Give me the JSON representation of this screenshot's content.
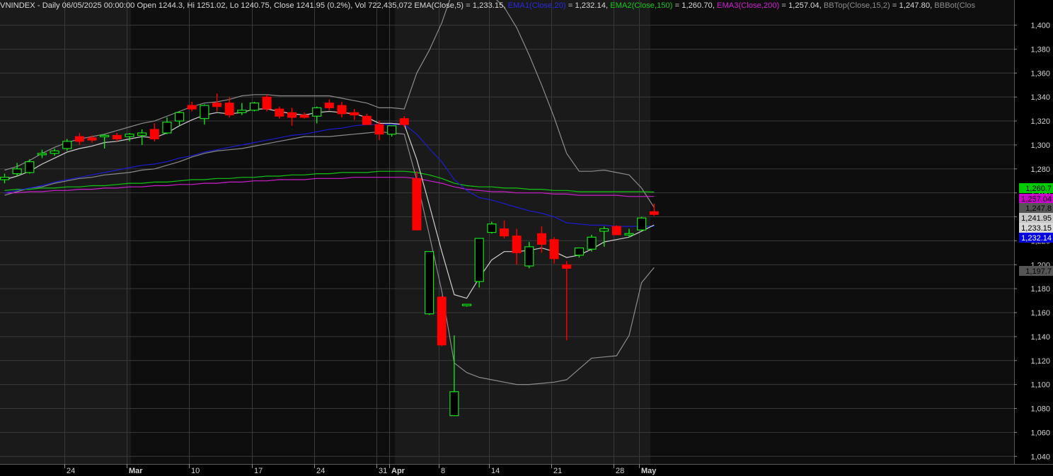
{
  "header": {
    "symbol": "VNINDEX",
    "period": "Daily",
    "datetime": "06/05/2025 00:00:00",
    "open_label": "Open",
    "open": "1244.3",
    "hi_label": "Hi",
    "hi": "1251.02",
    "lo_label": "Lo",
    "lo": "1240.75",
    "close_label": "Close",
    "close": "1241.95",
    "change": "(0.2%)",
    "vol_label": "Vol",
    "vol": "722,435,072",
    "ema5_label": "EMA(Close,5)",
    "ema5": "1,233.15",
    "ema1_label": "EMA1(Close,20)",
    "ema1": "1,232.14",
    "ema2_label": "EMA2(Close,150)",
    "ema2": "1,260.70",
    "ema3_label": "EMA3(Close,200)",
    "ema3": "1,257.04",
    "bbtop_label": "BBTop(Close,15,2)",
    "bbtop": "1,247.80",
    "bbbot_label": "BBBot(Clos"
  },
  "colors": {
    "background": "#000000",
    "band_light": "#1a1a1a",
    "band_dark": "#0e0e0e",
    "grid": "#3a3a3a",
    "up": "#18e018",
    "down": "#ff0000",
    "ema5": "#d0d0d0",
    "ema20": "#1c1ccf",
    "ema150": "#13c413",
    "ema200": "#cc1fcc",
    "bollinger": "#8c8c8c",
    "axis_text": "#d4d4d4"
  },
  "chart_data": {
    "type": "candlestick",
    "ylim": [
      1030,
      1410
    ],
    "yticks": [
      {
        "v": 1400,
        "label": "1,400"
      },
      {
        "v": 1380,
        "label": "1,380"
      },
      {
        "v": 1360,
        "label": "1,360"
      },
      {
        "v": 1340,
        "label": "1,340"
      },
      {
        "v": 1320,
        "label": "1,320"
      },
      {
        "v": 1300,
        "label": "1,300"
      },
      {
        "v": 1280,
        "label": "1,280"
      },
      {
        "v": 1260,
        "label": "1,260"
      },
      {
        "v": 1240,
        "label": "1,240"
      },
      {
        "v": 1220,
        "label": "1,220"
      },
      {
        "v": 1200,
        "label": "1,200"
      },
      {
        "v": 1180,
        "label": "1,180"
      },
      {
        "v": 1160,
        "label": "1,160"
      },
      {
        "v": 1140,
        "label": "1,140"
      },
      {
        "v": 1120,
        "label": "1,120"
      },
      {
        "v": 1100,
        "label": "1,100"
      },
      {
        "v": 1080,
        "label": "1,080"
      },
      {
        "v": 1060,
        "label": "1,060"
      },
      {
        "v": 1040,
        "label": "1,040"
      }
    ],
    "xticks": [
      {
        "i": 5,
        "label": "24",
        "bold": false
      },
      {
        "i": 10,
        "label": "Mar",
        "bold": true
      },
      {
        "i": 15,
        "label": "10",
        "bold": false
      },
      {
        "i": 20,
        "label": "17",
        "bold": false
      },
      {
        "i": 25,
        "label": "24",
        "bold": false
      },
      {
        "i": 30,
        "label": "31",
        "bold": false
      },
      {
        "i": 31,
        "label": "Apr",
        "bold": true
      },
      {
        "i": 35,
        "label": "8",
        "bold": false
      },
      {
        "i": 39,
        "label": "14",
        "bold": false
      },
      {
        "i": 44,
        "label": "21",
        "bold": false
      },
      {
        "i": 49,
        "label": "28",
        "bold": false
      },
      {
        "i": 51,
        "label": "May",
        "bold": true
      }
    ],
    "candles": [
      {
        "o": 1271,
        "h": 1276,
        "l": 1268,
        "c": 1273
      },
      {
        "o": 1276,
        "h": 1285,
        "l": 1274,
        "c": 1280
      },
      {
        "o": 1277,
        "h": 1288,
        "l": 1276,
        "c": 1286
      },
      {
        "o": 1292,
        "h": 1296,
        "l": 1289,
        "c": 1293
      },
      {
        "o": 1293,
        "h": 1297,
        "l": 1291,
        "c": 1295
      },
      {
        "o": 1297,
        "h": 1305,
        "l": 1295,
        "c": 1303
      },
      {
        "o": 1307,
        "h": 1310,
        "l": 1300,
        "c": 1303
      },
      {
        "o": 1306,
        "h": 1308,
        "l": 1302,
        "c": 1304
      },
      {
        "o": 1307,
        "h": 1309,
        "l": 1297,
        "c": 1308
      },
      {
        "o": 1308,
        "h": 1310,
        "l": 1303,
        "c": 1305
      },
      {
        "o": 1307,
        "h": 1310,
        "l": 1303,
        "c": 1309
      },
      {
        "o": 1308,
        "h": 1313,
        "l": 1300,
        "c": 1310
      },
      {
        "o": 1313,
        "h": 1318,
        "l": 1303,
        "c": 1305
      },
      {
        "o": 1310,
        "h": 1323,
        "l": 1309,
        "c": 1319
      },
      {
        "o": 1320,
        "h": 1328,
        "l": 1316,
        "c": 1327
      },
      {
        "o": 1333,
        "h": 1336,
        "l": 1328,
        "c": 1330
      },
      {
        "o": 1322,
        "h": 1334,
        "l": 1317,
        "c": 1333
      },
      {
        "o": 1335,
        "h": 1343,
        "l": 1328,
        "c": 1332
      },
      {
        "o": 1335,
        "h": 1340,
        "l": 1323,
        "c": 1325
      },
      {
        "o": 1327,
        "h": 1335,
        "l": 1325,
        "c": 1329
      },
      {
        "o": 1329,
        "h": 1336,
        "l": 1328,
        "c": 1335
      },
      {
        "o": 1340,
        "h": 1342,
        "l": 1328,
        "c": 1330
      },
      {
        "o": 1330,
        "h": 1332,
        "l": 1322,
        "c": 1324
      },
      {
        "o": 1327,
        "h": 1331,
        "l": 1316,
        "c": 1323
      },
      {
        "o": 1325,
        "h": 1327,
        "l": 1322,
        "c": 1323
      },
      {
        "o": 1324,
        "h": 1332,
        "l": 1318,
        "c": 1331
      },
      {
        "o": 1335,
        "h": 1338,
        "l": 1329,
        "c": 1331
      },
      {
        "o": 1333,
        "h": 1336,
        "l": 1323,
        "c": 1326
      },
      {
        "o": 1327,
        "h": 1330,
        "l": 1321,
        "c": 1325
      },
      {
        "o": 1324,
        "h": 1326,
        "l": 1317,
        "c": 1317
      },
      {
        "o": 1317,
        "h": 1320,
        "l": 1304,
        "c": 1309
      },
      {
        "o": 1309,
        "h": 1316,
        "l": 1307,
        "c": 1316
      },
      {
        "o": 1322,
        "h": 1324,
        "l": 1315,
        "c": 1317
      },
      {
        "o": 1272,
        "h": 1278,
        "l": 1229,
        "c": 1229
      },
      {
        "o": 1159,
        "h": 1211,
        "l": 1158,
        "c": 1211
      },
      {
        "o": 1173,
        "h": 1174,
        "l": 1132,
        "c": 1133
      },
      {
        "o": 1074,
        "h": 1141,
        "l": 1074,
        "c": 1094
      },
      {
        "o": 1166,
        "h": 1167,
        "l": 1165,
        "c": 1167
      },
      {
        "o": 1186,
        "h": 1222,
        "l": 1181,
        "c": 1222
      },
      {
        "o": 1227,
        "h": 1236,
        "l": 1226,
        "c": 1234
      },
      {
        "o": 1230,
        "h": 1237,
        "l": 1222,
        "c": 1224
      },
      {
        "o": 1224,
        "h": 1230,
        "l": 1200,
        "c": 1210
      },
      {
        "o": 1199,
        "h": 1219,
        "l": 1197,
        "c": 1215
      },
      {
        "o": 1226,
        "h": 1232,
        "l": 1210,
        "c": 1217
      },
      {
        "o": 1221,
        "h": 1223,
        "l": 1201,
        "c": 1205
      },
      {
        "o": 1200,
        "h": 1203,
        "l": 1137,
        "c": 1197
      },
      {
        "o": 1208,
        "h": 1214,
        "l": 1206,
        "c": 1214
      },
      {
        "o": 1213,
        "h": 1225,
        "l": 1211,
        "c": 1223
      },
      {
        "o": 1228,
        "h": 1232,
        "l": 1215,
        "c": 1230
      },
      {
        "o": 1232,
        "h": 1233,
        "l": 1225,
        "c": 1225
      },
      {
        "o": 1226,
        "h": 1230,
        "l": 1223,
        "c": 1226
      },
      {
        "o": 1229,
        "h": 1240,
        "l": 1228,
        "c": 1239
      },
      {
        "o": 1244.3,
        "h": 1251.02,
        "l": 1240.75,
        "c": 1241.95
      }
    ],
    "series": [
      {
        "name": "EMA(Close,5)",
        "color": "#d0d0d0",
        "values": [
          1271,
          1274,
          1278,
          1284,
          1289,
          1294,
          1297,
          1299,
          1302,
          1303,
          1305,
          1307,
          1306,
          1310,
          1316,
          1321,
          1325,
          1327,
          1326,
          1327,
          1330,
          1330,
          1328,
          1326,
          1325,
          1327,
          1328,
          1327,
          1326,
          1323,
          1318,
          1318,
          1317,
          1288,
          1250,
          1211,
          1175,
          1172,
          1189,
          1204,
          1211,
          1211,
          1212,
          1214,
          1211,
          1206,
          1208,
          1213,
          1219,
          1221,
          1223,
          1228,
          1233.15
        ]
      },
      {
        "name": "EMA1(Close,20)",
        "color": "#1c1ccf",
        "values": [
          1260,
          1262,
          1264,
          1266,
          1269,
          1271,
          1273,
          1275,
          1277,
          1279,
          1281,
          1283,
          1284,
          1286,
          1289,
          1291,
          1294,
          1296,
          1298,
          1300,
          1302,
          1304,
          1306,
          1308,
          1309,
          1311,
          1313,
          1314,
          1316,
          1317,
          1317,
          1317,
          1317,
          1309,
          1297,
          1286,
          1271,
          1262,
          1256,
          1254,
          1251,
          1248,
          1245,
          1243,
          1240,
          1235,
          1234,
          1233,
          1233,
          1232,
          1232,
          1232,
          1232.14
        ]
      },
      {
        "name": "EMA2(Close,150)",
        "color": "#13c413",
        "values": [
          1262,
          1263,
          1263,
          1264,
          1264,
          1265,
          1265,
          1266,
          1266,
          1267,
          1268,
          1268,
          1269,
          1269,
          1270,
          1271,
          1271,
          1272,
          1272,
          1273,
          1273,
          1274,
          1274,
          1275,
          1275,
          1276,
          1276,
          1277,
          1277,
          1277,
          1278,
          1278,
          1278,
          1277,
          1275,
          1272,
          1268,
          1266,
          1265,
          1265,
          1264,
          1264,
          1263,
          1263,
          1262,
          1262,
          1261,
          1261,
          1261,
          1261,
          1261,
          1261,
          1260.7
        ]
      },
      {
        "name": "EMA3(Close,200)",
        "color": "#cc1fcc",
        "values": [
          1260,
          1260,
          1261,
          1261,
          1262,
          1262,
          1263,
          1263,
          1264,
          1264,
          1265,
          1265,
          1266,
          1266,
          1267,
          1267,
          1268,
          1268,
          1269,
          1269,
          1270,
          1270,
          1271,
          1271,
          1271,
          1272,
          1272,
          1272,
          1273,
          1273,
          1273,
          1273,
          1273,
          1272,
          1270,
          1268,
          1265,
          1263,
          1262,
          1261,
          1261,
          1260,
          1260,
          1260,
          1259,
          1259,
          1258,
          1258,
          1258,
          1258,
          1257,
          1257,
          1257.04
        ]
      },
      {
        "name": "BBTop(Close,15,2)",
        "color": "#8c8c8c",
        "values": [
          1279,
          1282,
          1287,
          1293,
          1298,
          1302,
          1305,
          1307,
          1309,
          1312,
          1315,
          1318,
          1320,
          1324,
          1328,
          1332,
          1335,
          1336,
          1338,
          1341,
          1342,
          1342,
          1341,
          1341,
          1341,
          1341,
          1341,
          1339,
          1337,
          1335,
          1331,
          1331,
          1330,
          1360,
          1379,
          1402,
          1432,
          1432,
          1433,
          1425,
          1415,
          1398,
          1375,
          1350,
          1323,
          1293,
          1278,
          1278,
          1279,
          1277,
          1275,
          1264,
          1247.8
        ]
      },
      {
        "name": "BBBot(Close,15,2)",
        "color": "#8c8c8c",
        "values": [
          1258,
          1261,
          1264,
          1265,
          1268,
          1270,
          1272,
          1273,
          1275,
          1276,
          1277,
          1279,
          1280,
          1283,
          1286,
          1290,
          1293,
          1295,
          1296,
          1297,
          1299,
          1301,
          1303,
          1305,
          1307,
          1307,
          1307,
          1308,
          1309,
          1310,
          1311,
          1310,
          1309,
          1271,
          1225,
          1178,
          1118,
          1110,
          1106,
          1104,
          1102,
          1100,
          1100,
          1101,
          1102,
          1104,
          1113,
          1122,
          1123,
          1124,
          1141,
          1185,
          1197.7
        ]
      }
    ],
    "price_tags": [
      {
        "label": "1,260.7",
        "v": 1260.7,
        "bg": "#00cc00",
        "fg": "#000000"
      },
      {
        "label": "1,257.04",
        "v": 1257.04,
        "bg": "#cc00cc",
        "fg": "#000000"
      },
      {
        "label": "1,247.8",
        "v": 1247.8,
        "bg": "#555555",
        "fg": "#000000"
      },
      {
        "label": "1,241.95",
        "v": 1241.95,
        "bg": "#c8c8c8",
        "fg": "#000000"
      },
      {
        "label": "1,233.15",
        "v": 1233.15,
        "bg": "#d8d8d8",
        "fg": "#000000"
      },
      {
        "label": "1,232.14",
        "v": 1232.14,
        "bg": "#0000e0",
        "fg": "#ffffff"
      },
      {
        "label": "1,197.7",
        "v": 1197.7,
        "bg": "#555555",
        "fg": "#000000"
      }
    ]
  }
}
